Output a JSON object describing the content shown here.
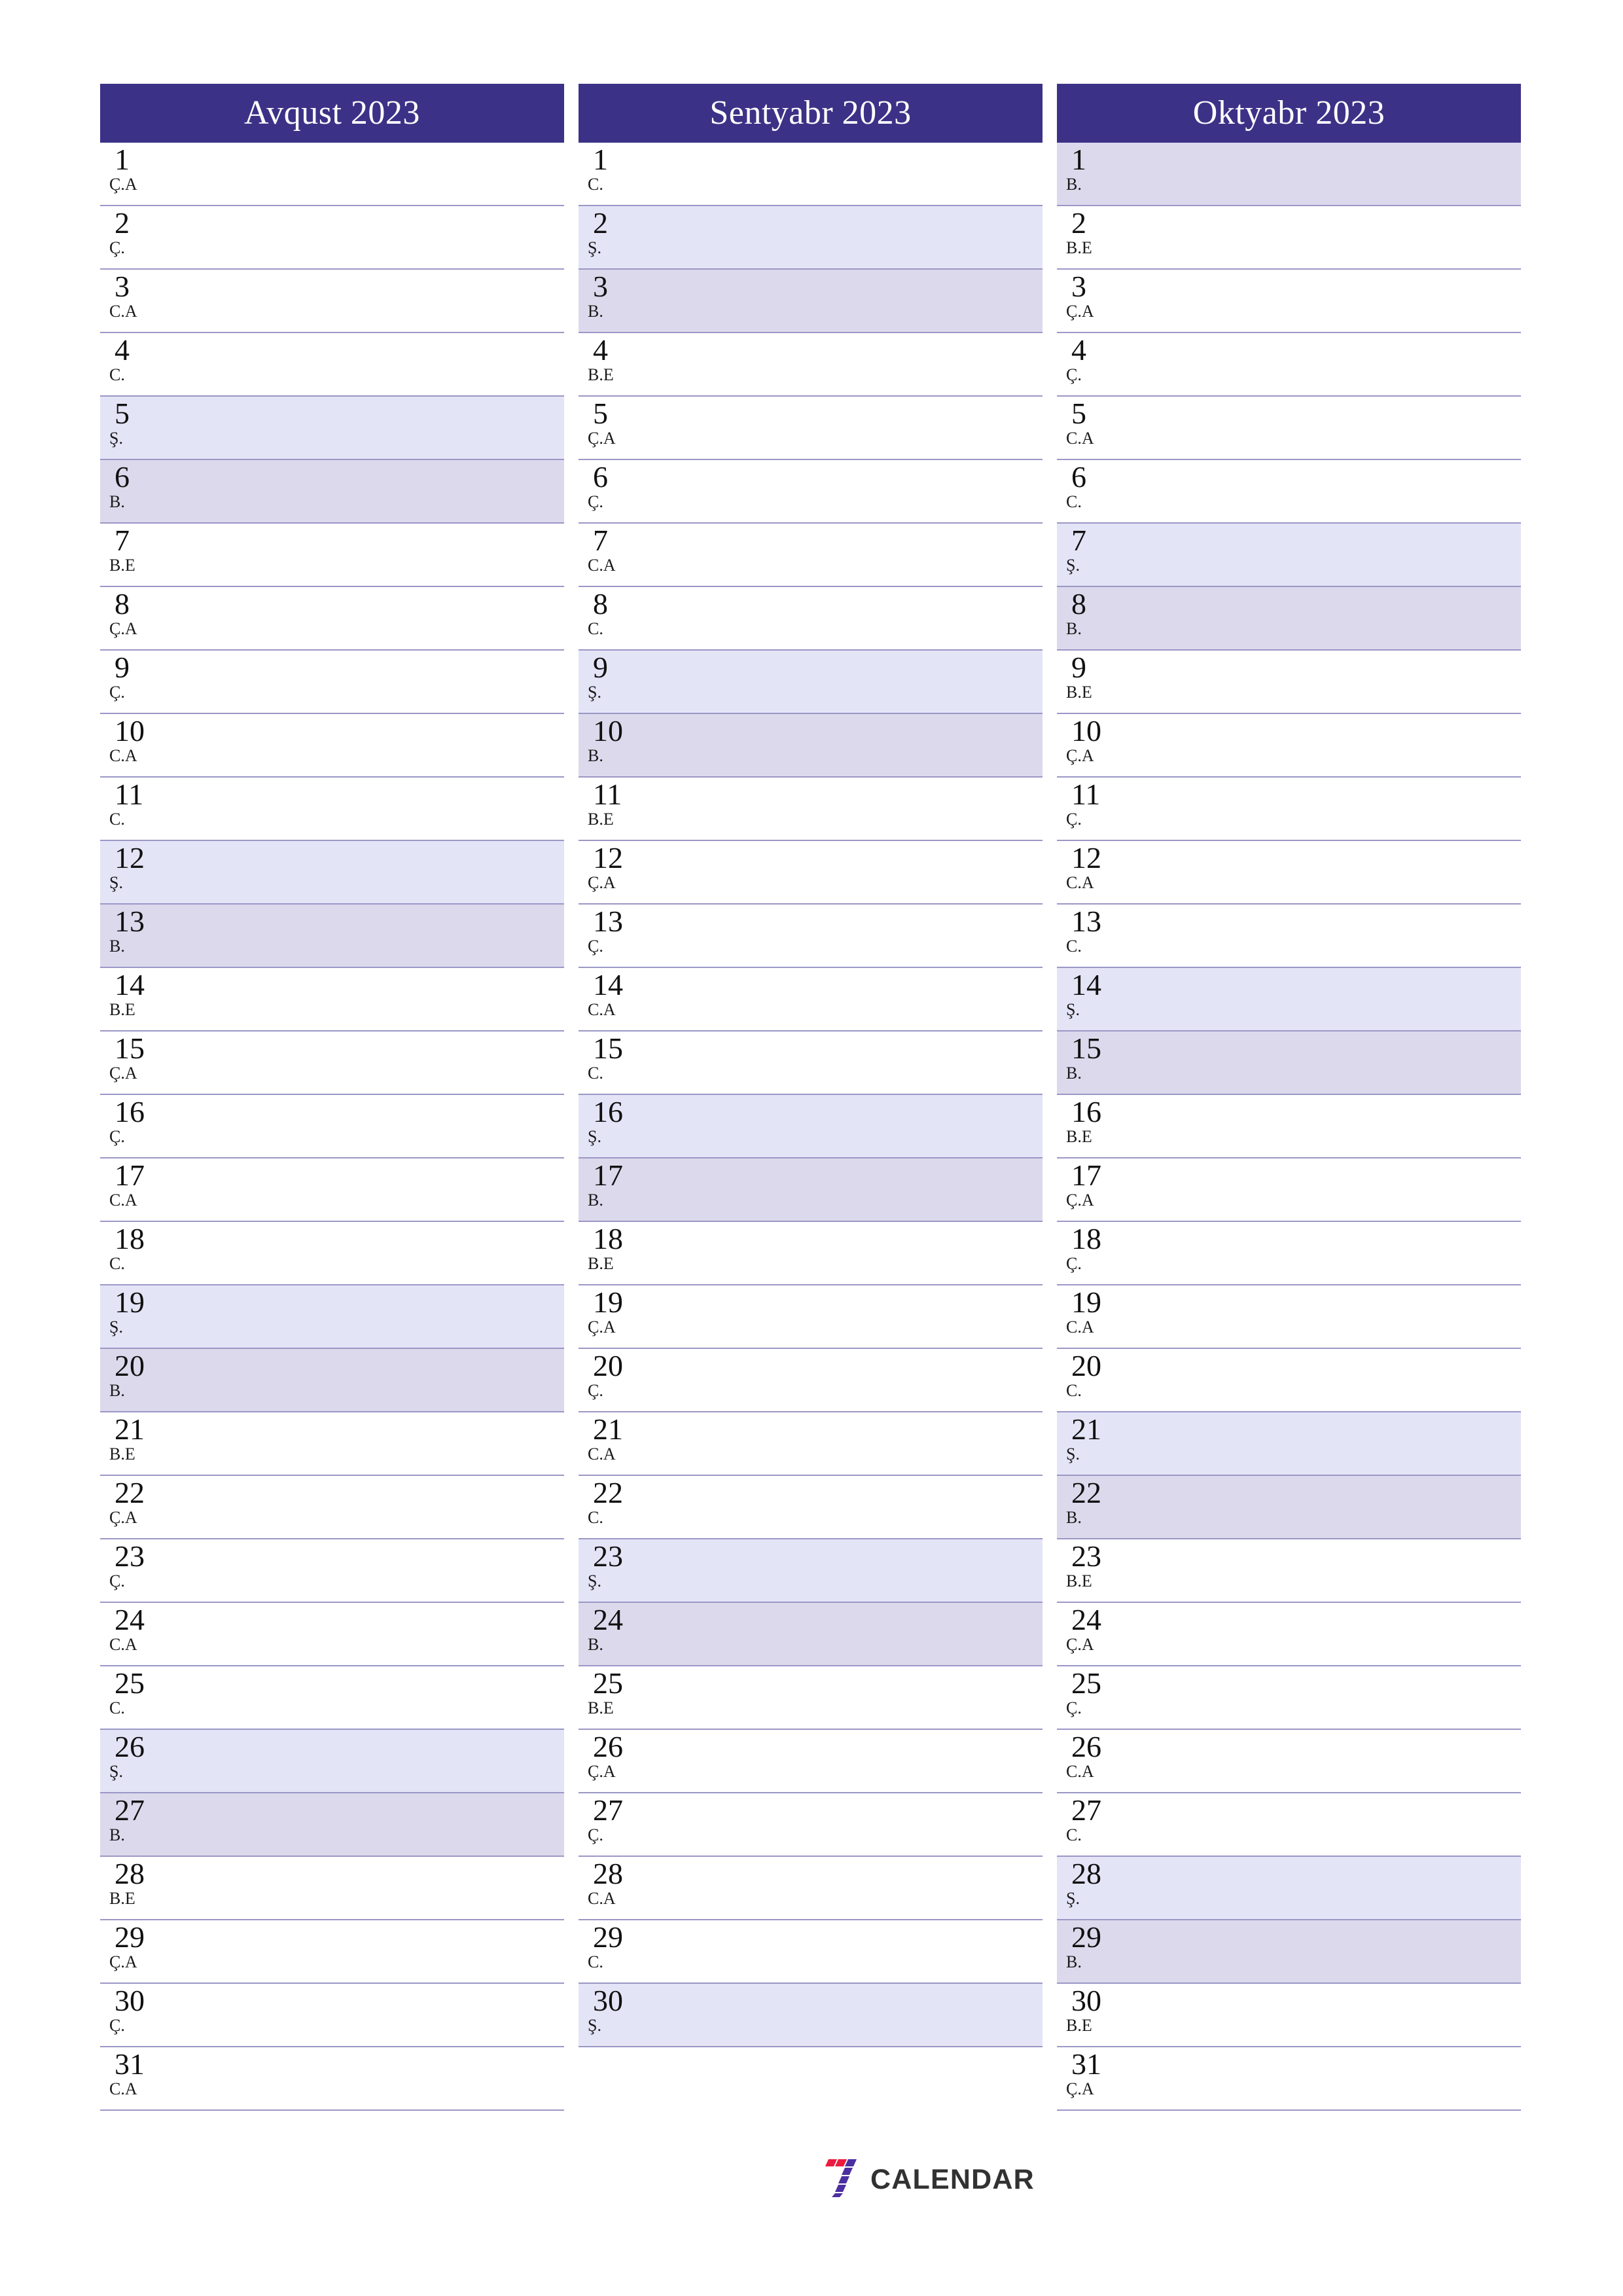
{
  "page": {
    "type": "three-month-planner",
    "year": "2023",
    "background_color": "#ffffff",
    "header_color": "#3b3287",
    "saturday_color": "#e4e4f7",
    "sunday_color": "#dcd9ec",
    "separator_color": "#9b97c6",
    "language": "Azerbaijani"
  },
  "weekday_legend": {
    "monday": "B.E",
    "tuesday": "Ç.A",
    "wednesday": "Ç.",
    "thursday": "C.A",
    "friday": "C.",
    "saturday": "Ş.",
    "sunday": "B."
  },
  "brand": {
    "mark_name": "seven-calendar-logo",
    "wordmark": "CALENDAR",
    "accent_red": "#ed1b3e",
    "accent_purple": "#4b2fa0",
    "wordmark_color": "#323232"
  },
  "months": [
    {
      "title": "Avqust 2023",
      "name": "Avqust",
      "days": [
        {
          "num": "1",
          "wd": "Ç.A",
          "kind": "weekday"
        },
        {
          "num": "2",
          "wd": "Ç.",
          "kind": "weekday"
        },
        {
          "num": "3",
          "wd": "C.A",
          "kind": "weekday"
        },
        {
          "num": "4",
          "wd": "C.",
          "kind": "weekday"
        },
        {
          "num": "5",
          "wd": "Ş.",
          "kind": "sat"
        },
        {
          "num": "6",
          "wd": "B.",
          "kind": "sun"
        },
        {
          "num": "7",
          "wd": "B.E",
          "kind": "weekday"
        },
        {
          "num": "8",
          "wd": "Ç.A",
          "kind": "weekday"
        },
        {
          "num": "9",
          "wd": "Ç.",
          "kind": "weekday"
        },
        {
          "num": "10",
          "wd": "C.A",
          "kind": "weekday"
        },
        {
          "num": "11",
          "wd": "C.",
          "kind": "weekday"
        },
        {
          "num": "12",
          "wd": "Ş.",
          "kind": "sat"
        },
        {
          "num": "13",
          "wd": "B.",
          "kind": "sun"
        },
        {
          "num": "14",
          "wd": "B.E",
          "kind": "weekday"
        },
        {
          "num": "15",
          "wd": "Ç.A",
          "kind": "weekday"
        },
        {
          "num": "16",
          "wd": "Ç.",
          "kind": "weekday"
        },
        {
          "num": "17",
          "wd": "C.A",
          "kind": "weekday"
        },
        {
          "num": "18",
          "wd": "C.",
          "kind": "weekday"
        },
        {
          "num": "19",
          "wd": "Ş.",
          "kind": "sat"
        },
        {
          "num": "20",
          "wd": "B.",
          "kind": "sun"
        },
        {
          "num": "21",
          "wd": "B.E",
          "kind": "weekday"
        },
        {
          "num": "22",
          "wd": "Ç.A",
          "kind": "weekday"
        },
        {
          "num": "23",
          "wd": "Ç.",
          "kind": "weekday"
        },
        {
          "num": "24",
          "wd": "C.A",
          "kind": "weekday"
        },
        {
          "num": "25",
          "wd": "C.",
          "kind": "weekday"
        },
        {
          "num": "26",
          "wd": "Ş.",
          "kind": "sat"
        },
        {
          "num": "27",
          "wd": "B.",
          "kind": "sun"
        },
        {
          "num": "28",
          "wd": "B.E",
          "kind": "weekday"
        },
        {
          "num": "29",
          "wd": "Ç.A",
          "kind": "weekday"
        },
        {
          "num": "30",
          "wd": "Ç.",
          "kind": "weekday"
        },
        {
          "num": "31",
          "wd": "C.A",
          "kind": "weekday"
        }
      ]
    },
    {
      "title": "Sentyabr 2023",
      "name": "Sentyabr",
      "days": [
        {
          "num": "1",
          "wd": "C.",
          "kind": "weekday"
        },
        {
          "num": "2",
          "wd": "Ş.",
          "kind": "sat"
        },
        {
          "num": "3",
          "wd": "B.",
          "kind": "sun"
        },
        {
          "num": "4",
          "wd": "B.E",
          "kind": "weekday"
        },
        {
          "num": "5",
          "wd": "Ç.A",
          "kind": "weekday"
        },
        {
          "num": "6",
          "wd": "Ç.",
          "kind": "weekday"
        },
        {
          "num": "7",
          "wd": "C.A",
          "kind": "weekday"
        },
        {
          "num": "8",
          "wd": "C.",
          "kind": "weekday"
        },
        {
          "num": "9",
          "wd": "Ş.",
          "kind": "sat"
        },
        {
          "num": "10",
          "wd": "B.",
          "kind": "sun"
        },
        {
          "num": "11",
          "wd": "B.E",
          "kind": "weekday"
        },
        {
          "num": "12",
          "wd": "Ç.A",
          "kind": "weekday"
        },
        {
          "num": "13",
          "wd": "Ç.",
          "kind": "weekday"
        },
        {
          "num": "14",
          "wd": "C.A",
          "kind": "weekday"
        },
        {
          "num": "15",
          "wd": "C.",
          "kind": "weekday"
        },
        {
          "num": "16",
          "wd": "Ş.",
          "kind": "sat"
        },
        {
          "num": "17",
          "wd": "B.",
          "kind": "sun"
        },
        {
          "num": "18",
          "wd": "B.E",
          "kind": "weekday"
        },
        {
          "num": "19",
          "wd": "Ç.A",
          "kind": "weekday"
        },
        {
          "num": "20",
          "wd": "Ç.",
          "kind": "weekday"
        },
        {
          "num": "21",
          "wd": "C.A",
          "kind": "weekday"
        },
        {
          "num": "22",
          "wd": "C.",
          "kind": "weekday"
        },
        {
          "num": "23",
          "wd": "Ş.",
          "kind": "sat"
        },
        {
          "num": "24",
          "wd": "B.",
          "kind": "sun"
        },
        {
          "num": "25",
          "wd": "B.E",
          "kind": "weekday"
        },
        {
          "num": "26",
          "wd": "Ç.A",
          "kind": "weekday"
        },
        {
          "num": "27",
          "wd": "Ç.",
          "kind": "weekday"
        },
        {
          "num": "28",
          "wd": "C.A",
          "kind": "weekday"
        },
        {
          "num": "29",
          "wd": "C.",
          "kind": "weekday"
        },
        {
          "num": "30",
          "wd": "Ş.",
          "kind": "sat"
        }
      ]
    },
    {
      "title": "Oktyabr 2023",
      "name": "Oktyabr",
      "days": [
        {
          "num": "1",
          "wd": "B.",
          "kind": "sun"
        },
        {
          "num": "2",
          "wd": "B.E",
          "kind": "weekday"
        },
        {
          "num": "3",
          "wd": "Ç.A",
          "kind": "weekday"
        },
        {
          "num": "4",
          "wd": "Ç.",
          "kind": "weekday"
        },
        {
          "num": "5",
          "wd": "C.A",
          "kind": "weekday"
        },
        {
          "num": "6",
          "wd": "C.",
          "kind": "weekday"
        },
        {
          "num": "7",
          "wd": "Ş.",
          "kind": "sat"
        },
        {
          "num": "8",
          "wd": "B.",
          "kind": "sun"
        },
        {
          "num": "9",
          "wd": "B.E",
          "kind": "weekday"
        },
        {
          "num": "10",
          "wd": "Ç.A",
          "kind": "weekday"
        },
        {
          "num": "11",
          "wd": "Ç.",
          "kind": "weekday"
        },
        {
          "num": "12",
          "wd": "C.A",
          "kind": "weekday"
        },
        {
          "num": "13",
          "wd": "C.",
          "kind": "weekday"
        },
        {
          "num": "14",
          "wd": "Ş.",
          "kind": "sat"
        },
        {
          "num": "15",
          "wd": "B.",
          "kind": "sun"
        },
        {
          "num": "16",
          "wd": "B.E",
          "kind": "weekday"
        },
        {
          "num": "17",
          "wd": "Ç.A",
          "kind": "weekday"
        },
        {
          "num": "18",
          "wd": "Ç.",
          "kind": "weekday"
        },
        {
          "num": "19",
          "wd": "C.A",
          "kind": "weekday"
        },
        {
          "num": "20",
          "wd": "C.",
          "kind": "weekday"
        },
        {
          "num": "21",
          "wd": "Ş.",
          "kind": "sat"
        },
        {
          "num": "22",
          "wd": "B.",
          "kind": "sun"
        },
        {
          "num": "23",
          "wd": "B.E",
          "kind": "weekday"
        },
        {
          "num": "24",
          "wd": "Ç.A",
          "kind": "weekday"
        },
        {
          "num": "25",
          "wd": "Ç.",
          "kind": "weekday"
        },
        {
          "num": "26",
          "wd": "C.A",
          "kind": "weekday"
        },
        {
          "num": "27",
          "wd": "C.",
          "kind": "weekday"
        },
        {
          "num": "28",
          "wd": "Ş.",
          "kind": "sat"
        },
        {
          "num": "29",
          "wd": "B.",
          "kind": "sun"
        },
        {
          "num": "30",
          "wd": "B.E",
          "kind": "weekday"
        },
        {
          "num": "31",
          "wd": "Ç.A",
          "kind": "weekday"
        }
      ]
    }
  ]
}
